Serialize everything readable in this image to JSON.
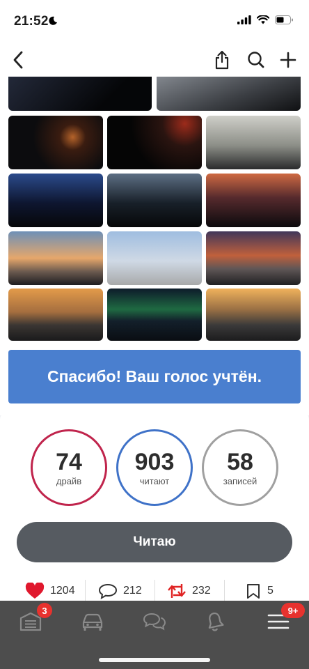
{
  "status_bar": {
    "time": "21:52"
  },
  "vote": {
    "message": "Спасибо! Ваш голос учтён."
  },
  "stats": {
    "drive": {
      "value": "74",
      "label": "драйв",
      "color": "#c0244c"
    },
    "readers": {
      "value": "903",
      "label": "читают",
      "color": "#3f72c8"
    },
    "posts": {
      "value": "58",
      "label": "записей",
      "color": "#a0a0a0"
    }
  },
  "follow_button": {
    "label": "Читаю"
  },
  "reactions": {
    "likes": "1204",
    "comments": "212",
    "reposts": "232",
    "bookmarks": "5"
  },
  "tab_bar": {
    "garage_badge": "3",
    "menu_badge": "9+"
  },
  "icons": [
    "back-icon",
    "share-icon",
    "search-icon",
    "add-icon",
    "heart-icon",
    "comment-icon",
    "repost-icon",
    "bookmark-icon",
    "garage-icon",
    "car-icon",
    "chat-icon",
    "bell-icon",
    "menu-icon"
  ],
  "colors": {
    "accent_blue": "#4a7fcf",
    "heart_red": "#e0182d",
    "repost_red": "#e02424",
    "tab_bar": "#4d4d4d",
    "follow_button": "#565b61"
  }
}
